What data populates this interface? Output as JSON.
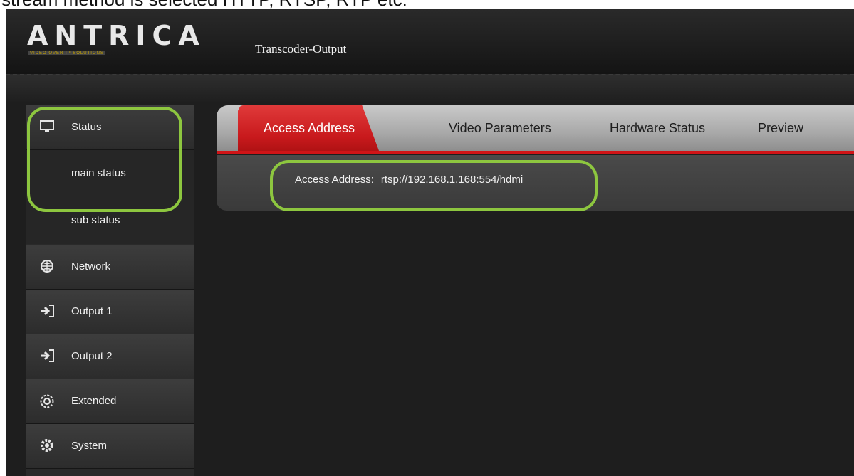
{
  "caption": "stream method is selected HTTP, RTSP, RTP etc.",
  "header": {
    "logo_text": "ANTRICA",
    "logo_tagline": "VIDEO OVER IP SOLUTIONS",
    "title": "Transcoder-Output"
  },
  "sidebar": {
    "status": {
      "label": "Status",
      "icon": "monitor-icon"
    },
    "sub_items": [
      {
        "label": "main status"
      },
      {
        "label": "sub status"
      }
    ],
    "items": [
      {
        "label": "Network",
        "icon": "globe-icon"
      },
      {
        "label": "Output 1",
        "icon": "output-icon"
      },
      {
        "label": "Output 2",
        "icon": "output-icon"
      },
      {
        "label": "Extended",
        "icon": "extended-gear-icon"
      },
      {
        "label": "System",
        "icon": "gear-icon"
      }
    ]
  },
  "tabs": [
    {
      "label": "Access Address",
      "active": true
    },
    {
      "label": "Video Parameters",
      "active": false
    },
    {
      "label": "Hardware Status",
      "active": false
    },
    {
      "label": "Preview",
      "active": false
    }
  ],
  "access": {
    "label": "Access Address:",
    "value": "rtsp://192.168.1.168:554/hdmi"
  },
  "colors": {
    "accent_red": "#d01417",
    "highlight_green": "#8dc63f",
    "background": "#1e1e1e"
  }
}
